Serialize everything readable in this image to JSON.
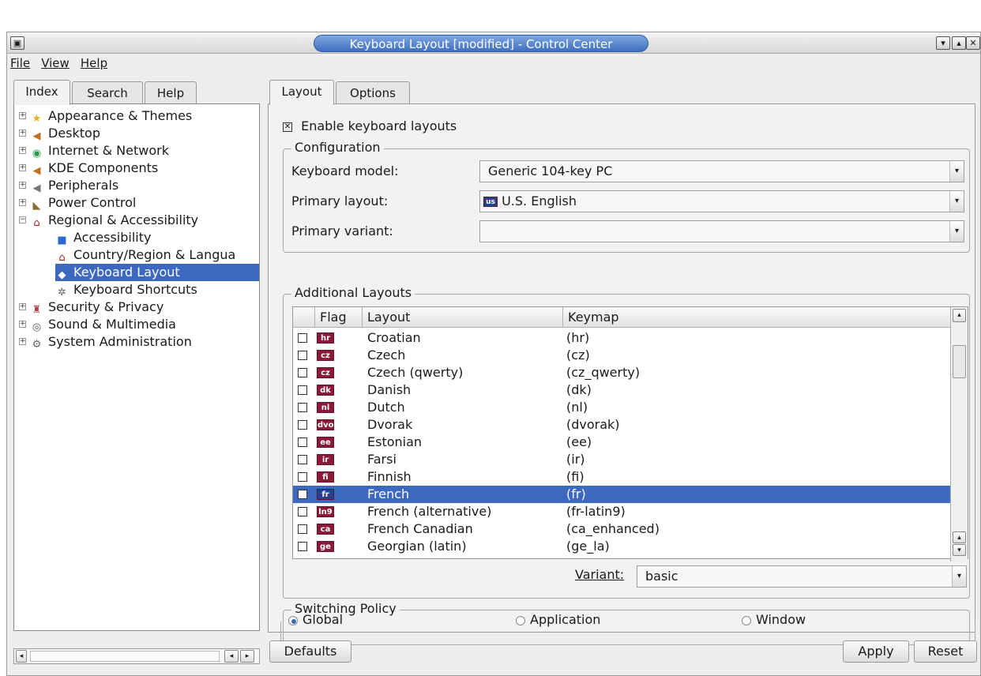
{
  "window": {
    "title": "Keyboard Layout [modified] - Control Center",
    "menu_icon": "window-menu-icon",
    "controls": [
      "minimize-icon",
      "maximize-icon",
      "close-icon"
    ]
  },
  "menubar": {
    "file": "File",
    "view": "View",
    "help": "Help"
  },
  "sidebar": {
    "tabs": [
      "Index",
      "Search",
      "Help"
    ],
    "tree": [
      {
        "label": "Appearance & Themes",
        "icon": "appearance-icon",
        "expander": "+"
      },
      {
        "label": "Desktop",
        "icon": "desktop-icon",
        "expander": "+"
      },
      {
        "label": "Internet & Network",
        "icon": "network-icon",
        "expander": "+"
      },
      {
        "label": "KDE Components",
        "icon": "kde-components-icon",
        "expander": "+"
      },
      {
        "label": "Peripherals",
        "icon": "peripherals-icon",
        "expander": "+"
      },
      {
        "label": "Power Control",
        "icon": "power-icon",
        "expander": "+"
      },
      {
        "label": "Regional & Accessibility",
        "icon": "regional-icon",
        "expander": "-"
      },
      {
        "label": "Accessibility",
        "icon": "accessibility-icon"
      },
      {
        "label": "Country/Region & Langua",
        "icon": "country-icon"
      },
      {
        "label": "Keyboard Layout",
        "icon": "keyboard-layout-icon",
        "selected": true
      },
      {
        "label": "Keyboard Shortcuts",
        "icon": "keyboard-shortcuts-icon"
      },
      {
        "label": "Security & Privacy",
        "icon": "security-icon",
        "expander": "+"
      },
      {
        "label": "Sound & Multimedia",
        "icon": "sound-icon",
        "expander": "+"
      },
      {
        "label": "System Administration",
        "icon": "system-admin-icon",
        "expander": "+"
      }
    ]
  },
  "main": {
    "tabs": [
      "Layout",
      "Options"
    ],
    "enable_label": "Enable keyboard layouts",
    "enable_checked": true,
    "configuration": {
      "legend": "Configuration",
      "model_label": "Keyboard model:",
      "model_value": "Generic 104-key PC",
      "primary_layout_label": "Primary layout:",
      "primary_layout_flag": "us",
      "primary_layout_value": "U.S. English",
      "primary_variant_label": "Primary variant:",
      "primary_variant_value": ""
    },
    "additional": {
      "legend": "Additional Layouts",
      "columns": [
        "Flag",
        "Layout",
        "Keymap"
      ],
      "rows": [
        {
          "flag": "hr",
          "layout": "Croatian",
          "keymap": "(hr)",
          "checked": false
        },
        {
          "flag": "cz",
          "layout": "Czech",
          "keymap": "(cz)",
          "checked": false
        },
        {
          "flag": "cz",
          "layout": "Czech (qwerty)",
          "keymap": "(cz_qwerty)",
          "checked": false
        },
        {
          "flag": "dk",
          "layout": "Danish",
          "keymap": "(dk)",
          "checked": false
        },
        {
          "flag": "nl",
          "layout": "Dutch",
          "keymap": "(nl)",
          "checked": false
        },
        {
          "flag": "dvo",
          "layout": "Dvorak",
          "keymap": "(dvorak)",
          "checked": false
        },
        {
          "flag": "ee",
          "layout": "Estonian",
          "keymap": "(ee)",
          "checked": false
        },
        {
          "flag": "ir",
          "layout": "Farsi",
          "keymap": "(ir)",
          "checked": false
        },
        {
          "flag": "fi",
          "layout": "Finnish",
          "keymap": "(fi)",
          "checked": false
        },
        {
          "flag": "fr",
          "layout": "French",
          "keymap": "(fr)",
          "checked": true,
          "selected": true
        },
        {
          "flag": "ln9",
          "layout": "French (alternative)",
          "keymap": "(fr-latin9)",
          "checked": false
        },
        {
          "flag": "ca",
          "layout": "French Canadian",
          "keymap": "(ca_enhanced)",
          "checked": false
        },
        {
          "flag": "ge",
          "layout": "Georgian (latin)",
          "keymap": "(ge_la)",
          "checked": false
        }
      ],
      "variant_label": "Variant:",
      "variant_value": "basic"
    },
    "switching": {
      "legend": "Switching Policy",
      "options": [
        "Global",
        "Application",
        "Window"
      ],
      "selected": "Global"
    }
  },
  "buttons": {
    "defaults": "Defaults",
    "apply": "Apply",
    "reset": "Reset"
  },
  "colors": {
    "selection": "#3d68c0",
    "title_pill": "#5b86d0"
  }
}
